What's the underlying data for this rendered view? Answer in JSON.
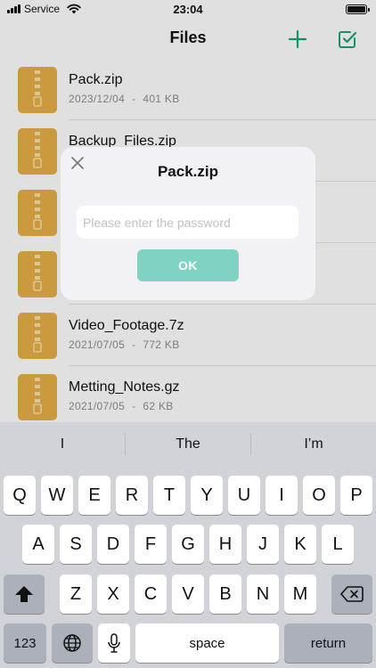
{
  "status_bar": {
    "carrier": "Service",
    "time": "23:04",
    "battery_level": 1.0
  },
  "nav": {
    "title": "Files",
    "add_icon": "plus-icon",
    "select_icon": "checkbox-icon",
    "accent_color": "#1aa37a"
  },
  "files": [
    {
      "name": "Pack.zip",
      "date": "2023/12/04",
      "separator": "-",
      "size": "401 KB"
    },
    {
      "name": "Backup_Files.zip",
      "date": "",
      "separator": "",
      "size": ""
    },
    {
      "name": "",
      "date": "",
      "separator": "",
      "size": ""
    },
    {
      "name": "",
      "date": "",
      "separator": "",
      "size": ""
    },
    {
      "name": "Video_Footage.7z",
      "date": "2021/07/05",
      "separator": "-",
      "size": "772 KB"
    },
    {
      "name": "Metting_Notes.gz",
      "date": "2021/07/05",
      "separator": "-",
      "size": "62 KB"
    }
  ],
  "file_icon_color": "#e8b048",
  "dialog": {
    "title": "Pack.zip",
    "close_icon": "close-icon",
    "password_value": "",
    "password_placeholder": "Please enter the password",
    "ok_label": "OK",
    "ok_color": "#7fd3c3"
  },
  "keyboard": {
    "suggestions": [
      "I",
      "The",
      "I’m"
    ],
    "row1": [
      "Q",
      "W",
      "E",
      "R",
      "T",
      "Y",
      "U",
      "I",
      "O",
      "P"
    ],
    "row2": [
      "A",
      "S",
      "D",
      "F",
      "G",
      "H",
      "J",
      "K",
      "L"
    ],
    "row3": [
      "Z",
      "X",
      "C",
      "V",
      "B",
      "N",
      "M"
    ],
    "shift_icon": "shift-icon",
    "backspace_icon": "backspace-icon",
    "numbers_label": "123",
    "globe_icon": "globe-icon",
    "mic_icon": "microphone-icon",
    "space_label": "space",
    "return_label": "return"
  }
}
